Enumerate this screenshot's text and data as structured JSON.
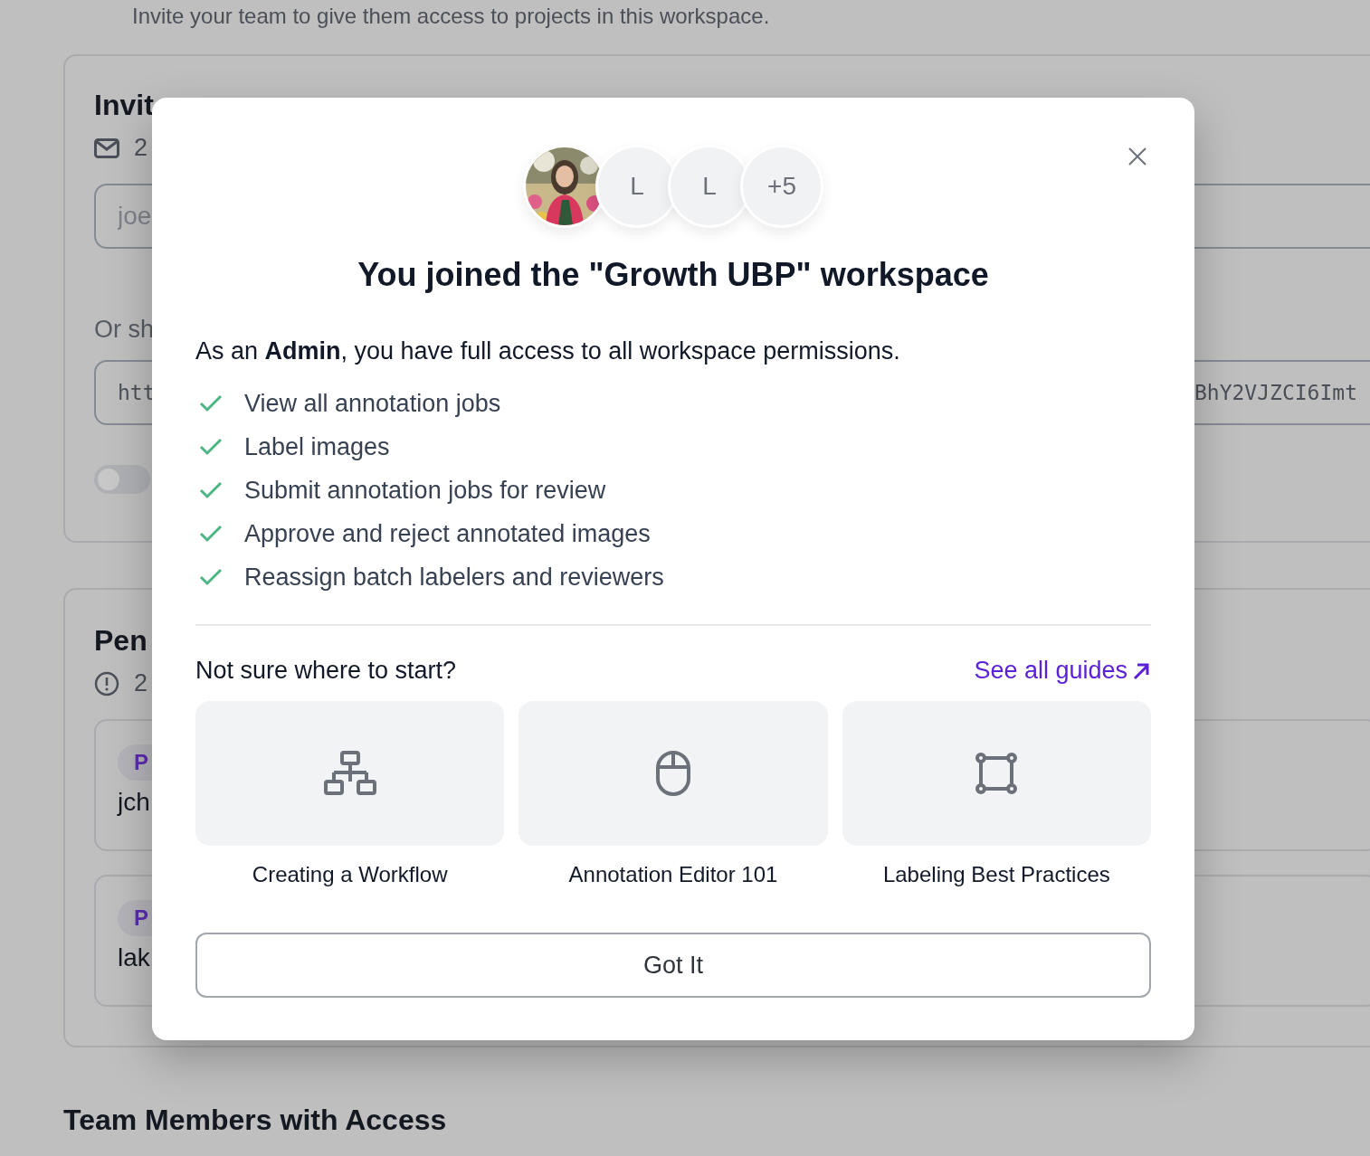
{
  "page": {
    "intro": "Invite your team to give them access to projects in this workspace.",
    "invite_card": {
      "title": "Invit",
      "email_count": "2",
      "email_field": {
        "placeholder": "joe"
      },
      "share_label": "Or sh",
      "link_field": {
        "value_start": "htt",
        "value_end": "BhY2VJZCI6Imt"
      },
      "toggle": {
        "on": false
      }
    },
    "pending_card": {
      "title": "Pen",
      "count": "2",
      "invites": [
        {
          "badge": "P",
          "email": "jch"
        },
        {
          "badge": "P",
          "email": "lak"
        }
      ]
    },
    "members_heading": "Team Members with Access"
  },
  "modal": {
    "avatars": [
      {
        "kind": "picture"
      },
      {
        "kind": "initial",
        "text": "L"
      },
      {
        "kind": "initial",
        "text": "L"
      },
      {
        "kind": "count",
        "text": "+5"
      }
    ],
    "title": "You joined the \"Growth UBP\" workspace",
    "intro": "As an **Admin**, you have full access to all workspace permissions.",
    "permissions": [
      "View all annotation jobs",
      "Label images",
      "Submit annotation jobs for review",
      "Approve and reject annotated images",
      "Reassign batch labelers and reviewers"
    ],
    "guides_heading": "Not sure where to start?",
    "guides_link": "See all guides",
    "guides": [
      {
        "kind": "workflow",
        "title": "Creating a Workflow"
      },
      {
        "kind": "mouse",
        "title": "Annotation Editor 101"
      },
      {
        "kind": "frame",
        "title": "Labeling Best Practices"
      }
    ],
    "button": "Got It"
  }
}
